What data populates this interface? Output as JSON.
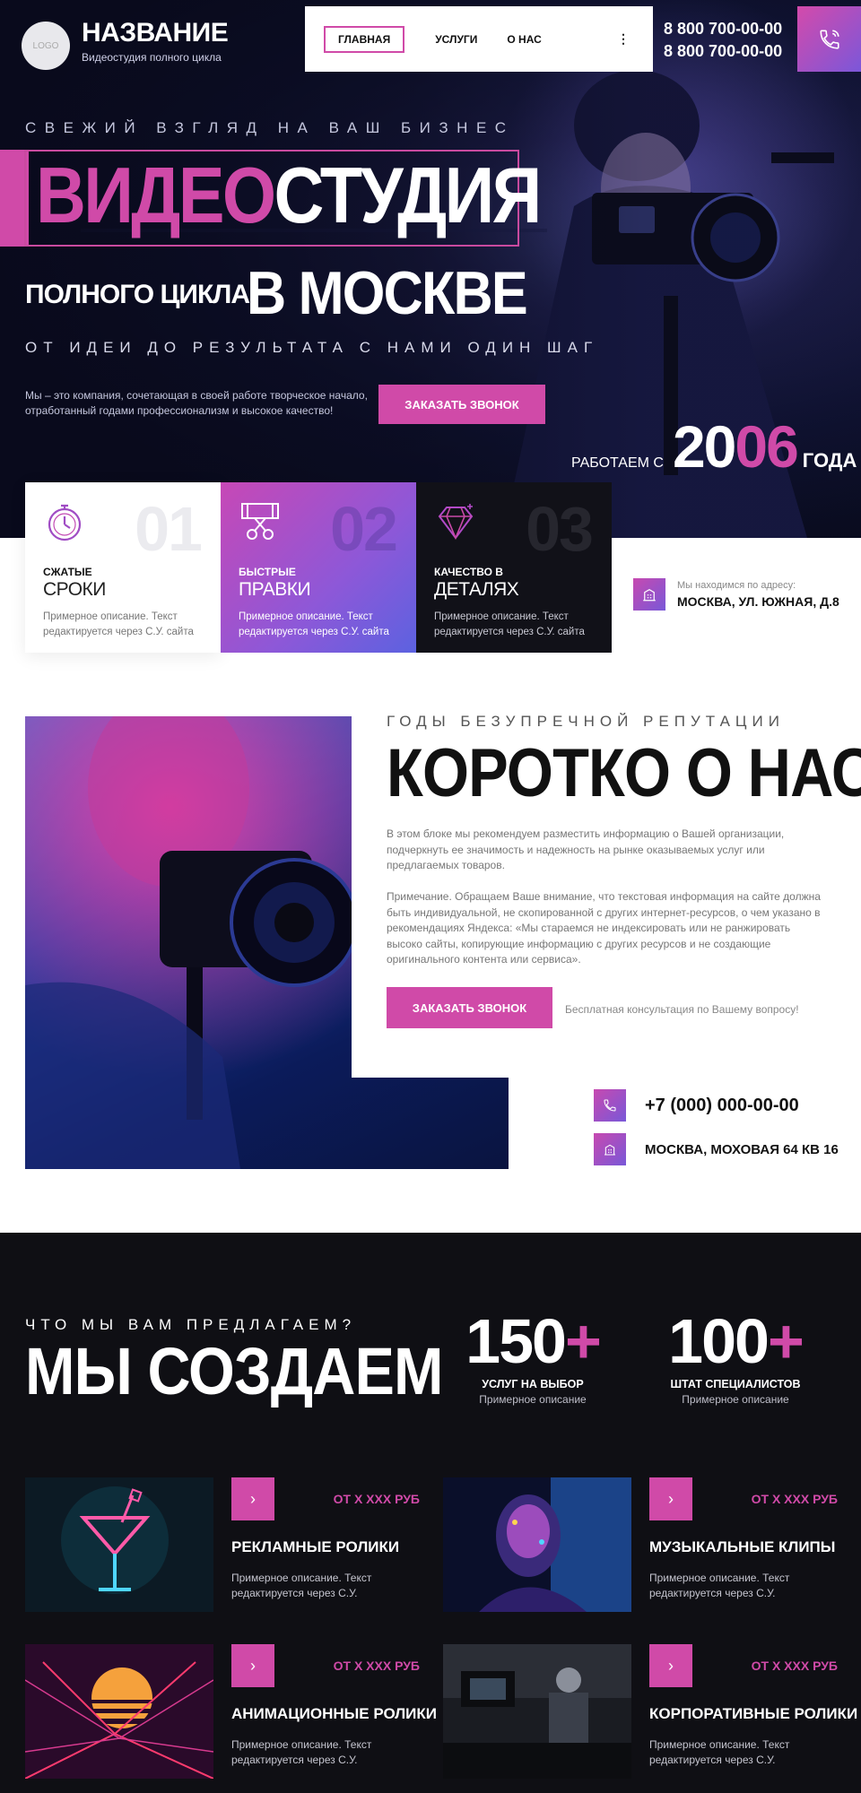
{
  "header": {
    "logo_text": "LOGO",
    "brand_name": "НАЗВАНИЕ",
    "brand_sub": "Видеостудия полного цикла",
    "nav": [
      "ГЛАВНАЯ",
      "УСЛУГИ",
      "О НАС"
    ],
    "nav_more": "⋮",
    "phone1": "8 800 700-00-00",
    "phone2": "8 800 700-00-00"
  },
  "hero": {
    "tagline": "СВЕЖИЙ ВЗГЛЯД НА ВАШ БИЗНЕС",
    "title_pink": "ВИДЕО",
    "title_white": "СТУДИЯ",
    "sub_left": "ПОЛНОГО ЦИКЛА",
    "sub_right": "В МОСКВЕ",
    "sub_tagline": "ОТ ИДЕИ ДО РЕЗУЛЬТАТА С НАМИ ОДИН ШАГ",
    "desc": "Мы – это компания, сочетающая в своей работе творческое начало, отработанный годами профессионализм и высокое качество!",
    "cta": "ЗАКАЗАТЬ ЗВОНОК",
    "since_label": "РАБОТАЕМ С",
    "year_white": "20",
    "year_pink": "06",
    "since_suffix": "ГОДА"
  },
  "features": [
    {
      "num": "01",
      "t1": "СЖАТЫЕ",
      "t2": "СРОКИ",
      "desc": "Примерное описание. Текст редактируется через С.У. сайта",
      "icon": "stopwatch-icon"
    },
    {
      "num": "02",
      "t1": "БЫСТРЫЕ",
      "t2": "ПРАВКИ",
      "desc": "Примерное описание. Текст редактируется через С.У. сайта",
      "icon": "film-scissors-icon"
    },
    {
      "num": "03",
      "t1": "КАЧЕСТВО В",
      "t2": "ДЕТАЛЯХ",
      "desc": "Примерное описание. Текст редактируется через С.У. сайта",
      "icon": "diamond-icon"
    }
  ],
  "address": {
    "label": "Мы находимся по адресу:",
    "value": "МОСКВА, УЛ. ЮЖНАЯ, Д.8"
  },
  "about": {
    "tagline": "ГОДЫ БЕЗУПРЕЧНОЙ РЕПУТАЦИИ",
    "title": "КОРОТКО О НАС",
    "p1": "В этом блоке мы рекомендуем разместить информацию о Вашей организации, подчеркнуть ее значимость и надежность на рынке оказываемых услуг или предлагаемых товаров.",
    "p2": "Примечание. Обращаем Ваше внимание, что текстовая информация на сайте должна быть индивидуальной, не скопированной с других интернет-ресурсов, о чем указано в рекомендациях Яндекса: «Мы стараемся не индексировать или не ранжировать высоко сайты, копирующие информацию с других ресурсов и не создающие оригинального контента или сервиса».",
    "cta": "ЗАКАЗАТЬ ЗВОНОК",
    "consult": "Бесплатная консультация по Вашему вопросу!",
    "phone": "+7 (000) 000-00-00",
    "address": "МОСКВА, МОХОВАЯ 64 КВ 16"
  },
  "services": {
    "tagline": "ЧТО МЫ ВАМ ПРЕДЛАГАЕМ?",
    "title": "МЫ СОЗДАЕМ",
    "stats": [
      {
        "num": "150",
        "plus": "+",
        "label": "УСЛУГ НА ВЫБОР",
        "desc": "Примерное описание"
      },
      {
        "num": "100",
        "plus": "+",
        "label": "ШТАТ СПЕЦИАЛИСТОВ",
        "desc": "Примерное описание"
      }
    ],
    "cards": [
      {
        "title": "РЕКЛАМНЫЕ РОЛИКИ",
        "price": "ОТ Х ХХХ РУБ",
        "desc": "Примерное описание. Текст редактируется через С.У.",
        "arrow": "›"
      },
      {
        "title": "МУЗЫКАЛЬНЫЕ КЛИПЫ",
        "price": "ОТ Х ХХХ РУБ",
        "desc": "Примерное описание. Текст редактируется через С.У.",
        "arrow": "›"
      },
      {
        "title": "АНИМАЦИОННЫЕ РОЛИКИ",
        "price": "ОТ Х ХХХ РУБ",
        "desc": "Примерное описание. Текст редактируется через С.У.",
        "arrow": "›"
      },
      {
        "title": "КОРПОРАТИВНЫЕ РОЛИКИ",
        "price": "ОТ Х ХХХ РУБ",
        "desc": "Примерное описание. Текст редактируется через С.У.",
        "arrow": "›"
      }
    ]
  },
  "colors": {
    "accent": "#d04aa8",
    "gradient_end": "#7b57d9",
    "dark_bg": "#0f0f14"
  }
}
